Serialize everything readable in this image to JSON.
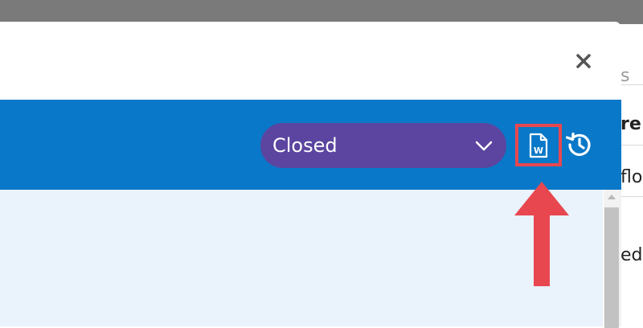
{
  "background_page": {
    "row1_text": "s",
    "row2_text": "re",
    "row3_text": "flo",
    "row4_text": "ed"
  },
  "modal": {
    "close_glyph": "✕",
    "status_select": {
      "selected_value": "Closed"
    },
    "word_export_icon_letter": "W"
  },
  "colors": {
    "toolbar": "#0a78c8",
    "status_pill": "#5b45a0",
    "highlight": "#e8474f",
    "content_bg": "#eaf2fb"
  },
  "icons": {
    "close": "close-icon",
    "chevron": "chevron-down-icon",
    "word_export": "word-document-icon",
    "history": "history-icon"
  }
}
